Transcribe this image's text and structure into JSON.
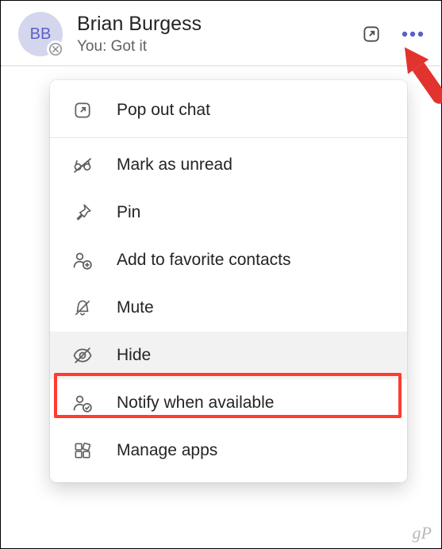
{
  "chat": {
    "avatar_initials": "BB",
    "name": "Brian Burgess",
    "preview": "You: Got it"
  },
  "menu": {
    "pop_out": "Pop out chat",
    "mark_unread": "Mark as unread",
    "pin": "Pin",
    "add_favorite": "Add to favorite contacts",
    "mute": "Mute",
    "hide": "Hide",
    "notify": "Notify when available",
    "manage_apps": "Manage apps"
  },
  "watermark": "gP"
}
